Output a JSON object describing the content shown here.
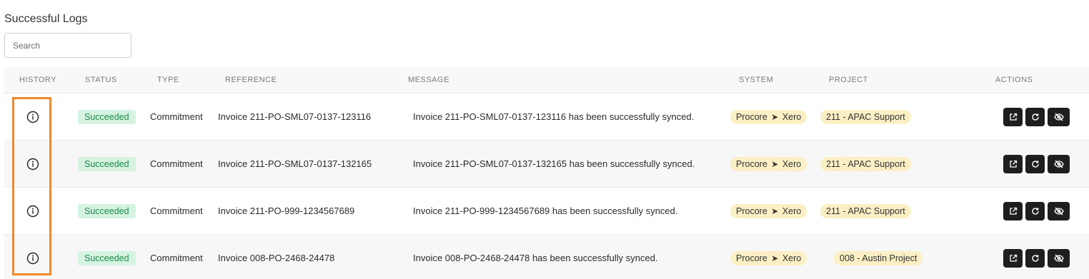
{
  "page": {
    "title": "Successful Logs"
  },
  "search": {
    "placeholder": "Search",
    "value": ""
  },
  "columns": {
    "history": "HISTORY",
    "status": "STATUS",
    "type": "TYPE",
    "reference": "REFERENCE",
    "message": "MESSAGE",
    "system": "SYSTEM",
    "project": "PROJECT",
    "actions": "ACTIONS"
  },
  "rows": [
    {
      "status": "Succeeded",
      "type": "Commitment",
      "reference": "Invoice 211-PO-SML07-0137-123116",
      "message": "Invoice 211-PO-SML07-0137-123116 has been successfully synced.",
      "system_from": "Procore",
      "system_to": "Xero",
      "project": "211 - APAC Support"
    },
    {
      "status": "Succeeded",
      "type": "Commitment",
      "reference": "Invoice 211-PO-SML07-0137-132165",
      "message": "Invoice 211-PO-SML07-0137-132165 has been successfully synced.",
      "system_from": "Procore",
      "system_to": "Xero",
      "project": "211 - APAC Support"
    },
    {
      "status": "Succeeded",
      "type": "Commitment",
      "reference": "Invoice 211-PO-999-1234567689",
      "message": "Invoice 211-PO-999-1234567689 has been successfully synced.",
      "system_from": "Procore",
      "system_to": "Xero",
      "project": "211 - APAC Support"
    },
    {
      "status": "Succeeded",
      "type": "Commitment",
      "reference": "Invoice 008-PO-2468-24478",
      "message": "Invoice 008-PO-2468-24478 has been successfully synced.",
      "system_from": "Procore",
      "system_to": "Xero",
      "project": "008 - Austin Project"
    }
  ],
  "icons": {
    "history": "info-circle-icon",
    "arrow": "arrow-right-icon",
    "actions": [
      "external-link-icon",
      "refresh-icon",
      "eye-off-icon"
    ]
  },
  "colors": {
    "status_success_bg": "#d6f3e2",
    "status_success_text": "#1c8a4a",
    "pill_bg": "#fbefc4",
    "action_button_bg": "#1e1e1e",
    "highlight": "#f0892e"
  }
}
